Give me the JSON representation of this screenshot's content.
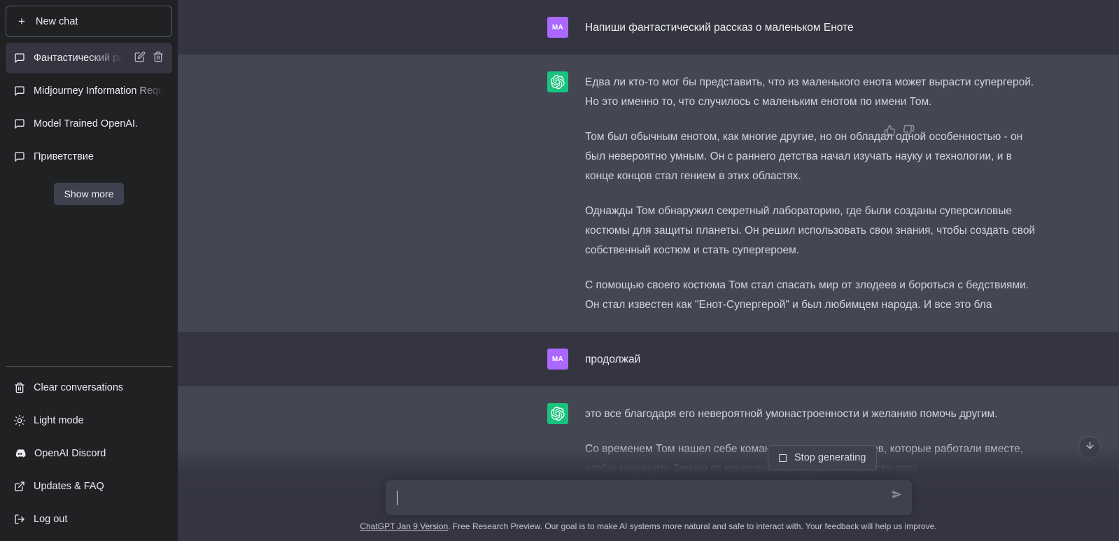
{
  "sidebar": {
    "new_chat_label": "New chat",
    "conversations": [
      {
        "label": "Фантастический рассказ",
        "active": true
      },
      {
        "label": "Midjourney Information Request",
        "active": false
      },
      {
        "label": "Model Trained OpenAI.",
        "active": false
      },
      {
        "label": "Приветствие",
        "active": false
      }
    ],
    "show_more_label": "Show more",
    "footer_items": [
      {
        "label": "Clear conversations",
        "icon": "trash-icon"
      },
      {
        "label": "Light mode",
        "icon": "sun-icon"
      },
      {
        "label": "OpenAI Discord",
        "icon": "discord-icon"
      },
      {
        "label": "Updates & FAQ",
        "icon": "external-link-icon"
      },
      {
        "label": "Log out",
        "icon": "logout-icon"
      }
    ]
  },
  "conversation": {
    "messages": [
      {
        "role": "user",
        "avatar_initials": "MA",
        "paragraphs": [
          "Напиши фантастический рассказ о маленьком Еноте"
        ]
      },
      {
        "role": "assistant",
        "paragraphs": [
          "Едва ли кто-то мог бы представить, что из маленького енота может вырасти супергерой. Но это именно то, что случилось с маленьким енотом по имени Том.",
          "Том был обычным енотом, как многие другие, но он обладал одной особенностью - он был невероятно умным. Он с раннего детства начал изучать науку и технологии, и в конце концов стал гением в этих областях.",
          "Однажды Том обнаружил секретный лабораторию, где были созданы суперсиловые костюмы для защиты планеты. Он решил использовать свои знания, чтобы создать свой собственный костюм и стать супергероем.",
          "С помощью своего костюма Том стал спасать мир от злодеев и бороться с бедствиями. Он стал известен как \"Енот-Супергерой\" и был любимцем народа. И все это бла"
        ]
      },
      {
        "role": "user",
        "avatar_initials": "MA",
        "paragraphs": [
          "продолжай"
        ]
      },
      {
        "role": "assistant",
        "paragraphs": [
          "это все благодаря его невероятной умонастроенности и желанию помочь другим.",
          "Со временем Том нашел себе команду других супергероев, которые работали вместе, чтобы защищать Землю от всевозможных угроз. Они вместе прот"
        ]
      }
    ]
  },
  "composer": {
    "stop_label": "Stop generating",
    "input_value": "",
    "input_placeholder": ""
  },
  "footer": {
    "link_text": "ChatGPT Jan 9 Version",
    "rest_text": ". Free Research Preview. Our goal is to make AI systems more natural and safe to interact with. Your feedback will help us improve."
  },
  "colors": {
    "sidebar_bg": "#202123",
    "user_msg_bg": "#343541",
    "bot_msg_bg": "#444654",
    "user_avatar": "#ab68ff",
    "bot_avatar": "#19c37d",
    "accent_text": "#ececf1"
  }
}
